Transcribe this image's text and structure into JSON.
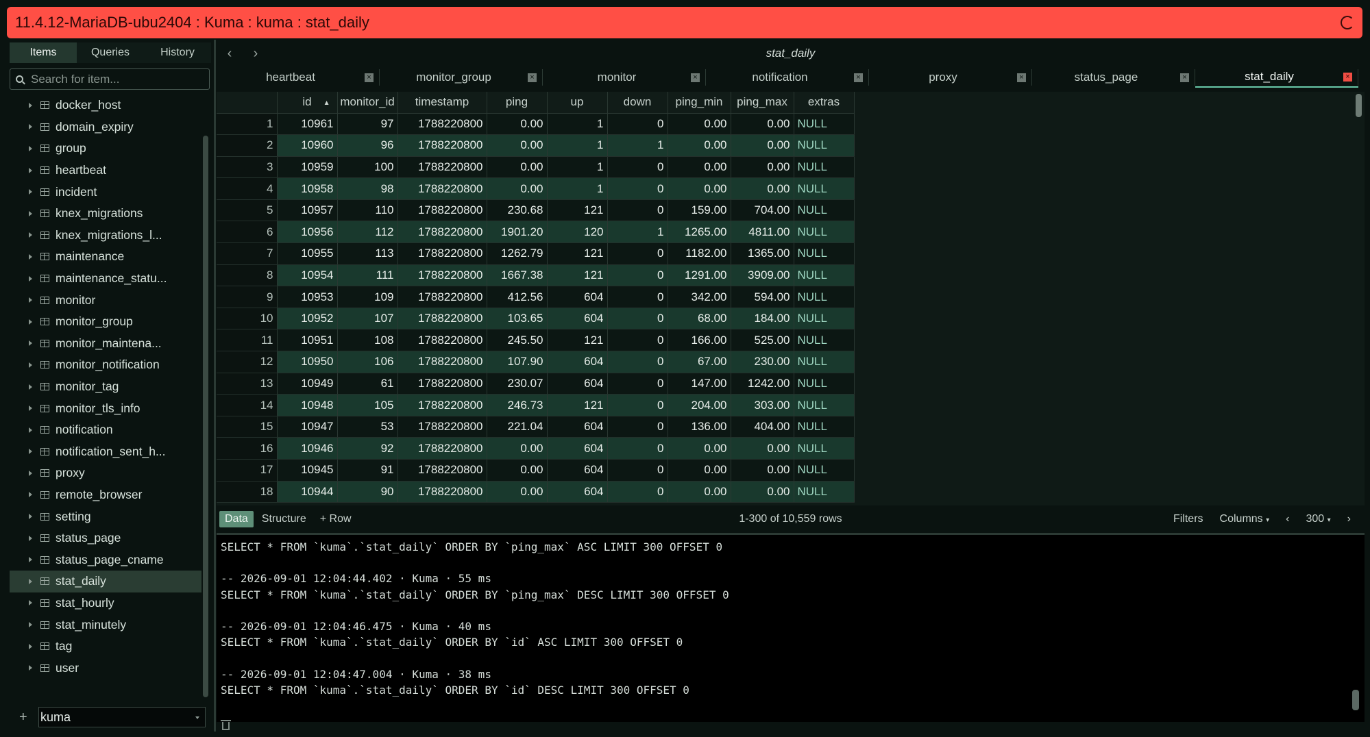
{
  "title": "11.4.12-MariaDB-ubu2404 : Kuma : kuma : stat_daily",
  "sidebar": {
    "tabs": [
      "Items",
      "Queries",
      "History"
    ],
    "search_placeholder": "Search for item...",
    "items": [
      "docker_host",
      "domain_expiry",
      "group",
      "heartbeat",
      "incident",
      "knex_migrations",
      "knex_migrations_l...",
      "maintenance",
      "maintenance_statu...",
      "monitor",
      "monitor_group",
      "monitor_maintena...",
      "monitor_notification",
      "monitor_tag",
      "monitor_tls_info",
      "notification",
      "notification_sent_h...",
      "proxy",
      "remote_browser",
      "setting",
      "status_page",
      "status_page_cname",
      "stat_daily",
      "stat_hourly",
      "stat_minutely",
      "tag",
      "user"
    ],
    "active_item": "stat_daily",
    "database": "kuma"
  },
  "main": {
    "title": "stat_daily",
    "tabs": [
      "heartbeat",
      "monitor_group",
      "monitor",
      "notification",
      "proxy",
      "status_page",
      "stat_daily"
    ],
    "active_tab": "stat_daily",
    "columns": [
      "id",
      "monitor_id",
      "timestamp",
      "ping",
      "up",
      "down",
      "ping_min",
      "ping_max",
      "extras"
    ],
    "rows": [
      [
        "10961",
        "97",
        "1788220800",
        "0.00",
        "1",
        "0",
        "0.00",
        "0.00",
        "NULL"
      ],
      [
        "10960",
        "96",
        "1788220800",
        "0.00",
        "1",
        "1",
        "0.00",
        "0.00",
        "NULL"
      ],
      [
        "10959",
        "100",
        "1788220800",
        "0.00",
        "1",
        "0",
        "0.00",
        "0.00",
        "NULL"
      ],
      [
        "10958",
        "98",
        "1788220800",
        "0.00",
        "1",
        "0",
        "0.00",
        "0.00",
        "NULL"
      ],
      [
        "10957",
        "110",
        "1788220800",
        "230.68",
        "121",
        "0",
        "159.00",
        "704.00",
        "NULL"
      ],
      [
        "10956",
        "112",
        "1788220800",
        "1901.20",
        "120",
        "1",
        "1265.00",
        "4811.00",
        "NULL"
      ],
      [
        "10955",
        "113",
        "1788220800",
        "1262.79",
        "121",
        "0",
        "1182.00",
        "1365.00",
        "NULL"
      ],
      [
        "10954",
        "111",
        "1788220800",
        "1667.38",
        "121",
        "0",
        "1291.00",
        "3909.00",
        "NULL"
      ],
      [
        "10953",
        "109",
        "1788220800",
        "412.56",
        "604",
        "0",
        "342.00",
        "594.00",
        "NULL"
      ],
      [
        "10952",
        "107",
        "1788220800",
        "103.65",
        "604",
        "0",
        "68.00",
        "184.00",
        "NULL"
      ],
      [
        "10951",
        "108",
        "1788220800",
        "245.50",
        "121",
        "0",
        "166.00",
        "525.00",
        "NULL"
      ],
      [
        "10950",
        "106",
        "1788220800",
        "107.90",
        "604",
        "0",
        "67.00",
        "230.00",
        "NULL"
      ],
      [
        "10949",
        "61",
        "1788220800",
        "230.07",
        "604",
        "0",
        "147.00",
        "1242.00",
        "NULL"
      ],
      [
        "10948",
        "105",
        "1788220800",
        "246.73",
        "121",
        "0",
        "204.00",
        "303.00",
        "NULL"
      ],
      [
        "10947",
        "53",
        "1788220800",
        "221.04",
        "604",
        "0",
        "136.00",
        "404.00",
        "NULL"
      ],
      [
        "10946",
        "92",
        "1788220800",
        "0.00",
        "604",
        "0",
        "0.00",
        "0.00",
        "NULL"
      ],
      [
        "10945",
        "91",
        "1788220800",
        "0.00",
        "604",
        "0",
        "0.00",
        "0.00",
        "NULL"
      ],
      [
        "10944",
        "90",
        "1788220800",
        "0.00",
        "604",
        "0",
        "0.00",
        "0.00",
        "NULL"
      ]
    ],
    "bar": {
      "data": "Data",
      "structure": "Structure",
      "add_row": "+ Row",
      "rows_info": "1-300 of 10,559 rows",
      "filters": "Filters",
      "columns": "Columns",
      "limit": "300"
    },
    "query_log": [
      "SELECT * FROM `kuma`.`stat_daily` ORDER BY `ping_max` ASC LIMIT 300 OFFSET 0",
      "",
      "-- 2026-09-01 12:04:44.402 · Kuma · 55 ms",
      "SELECT * FROM `kuma`.`stat_daily` ORDER BY `ping_max` DESC LIMIT 300 OFFSET 0",
      "",
      "-- 2026-09-01 12:04:46.475 · Kuma · 40 ms",
      "SELECT * FROM `kuma`.`stat_daily` ORDER BY `id` ASC LIMIT 300 OFFSET 0",
      "",
      "-- 2026-09-01 12:04:47.004 · Kuma · 38 ms",
      "SELECT * FROM `kuma`.`stat_daily` ORDER BY `id` DESC LIMIT 300 OFFSET 0"
    ]
  },
  "colors": {
    "titlebar": "#ff4f45",
    "accent": "#69c9a9",
    "row_alt": "#19392d"
  }
}
